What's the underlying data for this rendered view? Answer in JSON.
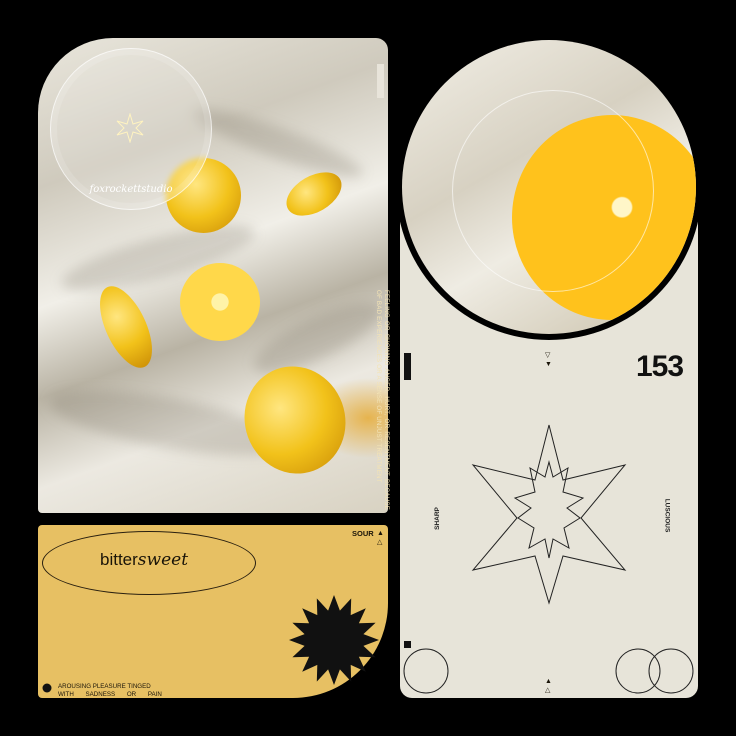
{
  "photo": {
    "watermark": "foxrockettstudio"
  },
  "definition_bitter": "FEELING OR SHOWING ANGER, HURT, OR RESENTMENT BECAUSE OF BAD EXPERIENCES OR A SENSE OF UNJUST TREATMENT",
  "card": {
    "word_plain": "bitter",
    "word_italic": "sweet",
    "label": "SOUR",
    "definition": [
      "AROUSING PLEASURE TINGED",
      "WITH SADNESS OR PAIN"
    ]
  },
  "info": {
    "number": "153",
    "left_label": "SHARP",
    "right_label": "LUSCIOUS"
  },
  "colors": {
    "yellow": "#e7c063",
    "cream": "#e7e4d9",
    "lemon": "#f2c21a"
  }
}
